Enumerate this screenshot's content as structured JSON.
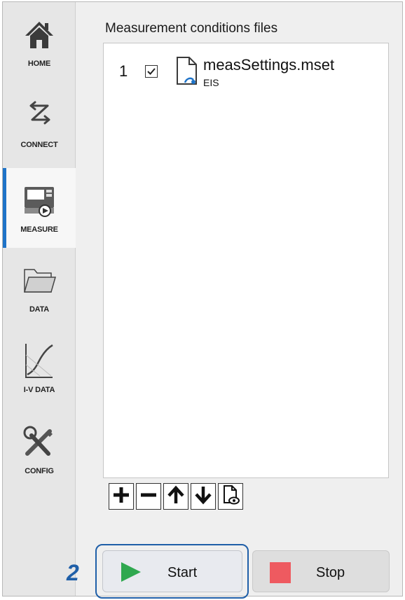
{
  "sidebar": {
    "items": [
      {
        "label": "HOME",
        "icon": "home-icon"
      },
      {
        "label": "CONNECT",
        "icon": "connect-icon"
      },
      {
        "label": "MEASURE",
        "icon": "measure-icon",
        "active": true
      },
      {
        "label": "DATA",
        "icon": "folder-icon"
      },
      {
        "label": "I-V DATA",
        "icon": "iv-curve-icon"
      },
      {
        "label": "CONFIG",
        "icon": "tools-icon"
      }
    ]
  },
  "main": {
    "title": "Measurement conditions files",
    "files": [
      {
        "index": "1",
        "checked": true,
        "name": "measSettings.mset",
        "type": "EIS"
      }
    ],
    "toolbar": [
      "add-icon",
      "remove-icon",
      "move-up-icon",
      "move-down-icon",
      "preview-file-icon"
    ]
  },
  "actions": {
    "step_number": "2",
    "start_label": "Start",
    "stop_label": "Stop"
  },
  "colors": {
    "accent": "#1e73c8",
    "start_icon": "#2fa84f",
    "stop_icon": "#ee5a60",
    "highlight": "#1f5fa8"
  }
}
